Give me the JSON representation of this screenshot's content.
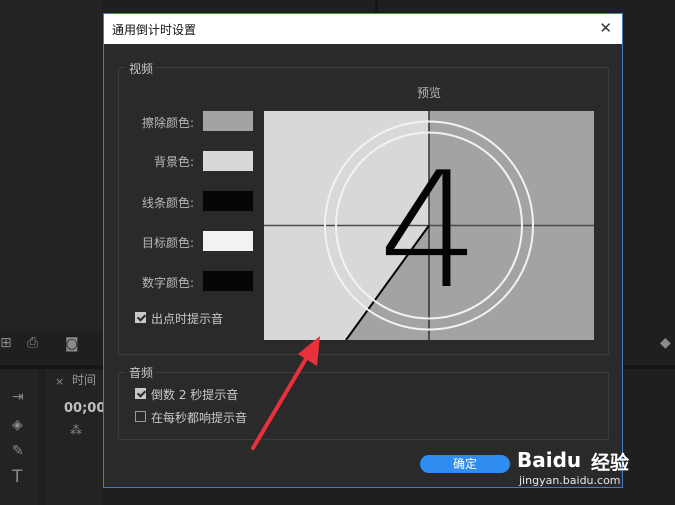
{
  "dialog": {
    "title": "通用倒计时设置",
    "close_glyph": "✕",
    "ok_label": "确定"
  },
  "video": {
    "group_label": "视频",
    "preview_label": "预览",
    "rows": [
      {
        "label": "擦除颜色:",
        "color": "#a3a3a3"
      },
      {
        "label": "背景色:",
        "color": "#d8d8d8"
      },
      {
        "label": "线条颜色:",
        "color": "#050505"
      },
      {
        "label": "目标颜色:",
        "color": "#f2f2f2"
      },
      {
        "label": "数字颜色:",
        "color": "#050505"
      }
    ],
    "cue_beep_label": "出点时提示音",
    "countdown_digit": "4"
  },
  "audio": {
    "group_label": "音频",
    "option1_label": "倒数 2 秒提示音",
    "option2_label": "在每秒都响提示音"
  },
  "background": {
    "tab_label": "时间",
    "timecode": "00;00",
    "tool_t": "T"
  },
  "watermark": {
    "brand": "Baidu",
    "jingyan": "经验",
    "url": "jingyan.baidu.com"
  },
  "colors": {
    "accent": "#2f8cf0",
    "arrow": "#e8313a"
  }
}
